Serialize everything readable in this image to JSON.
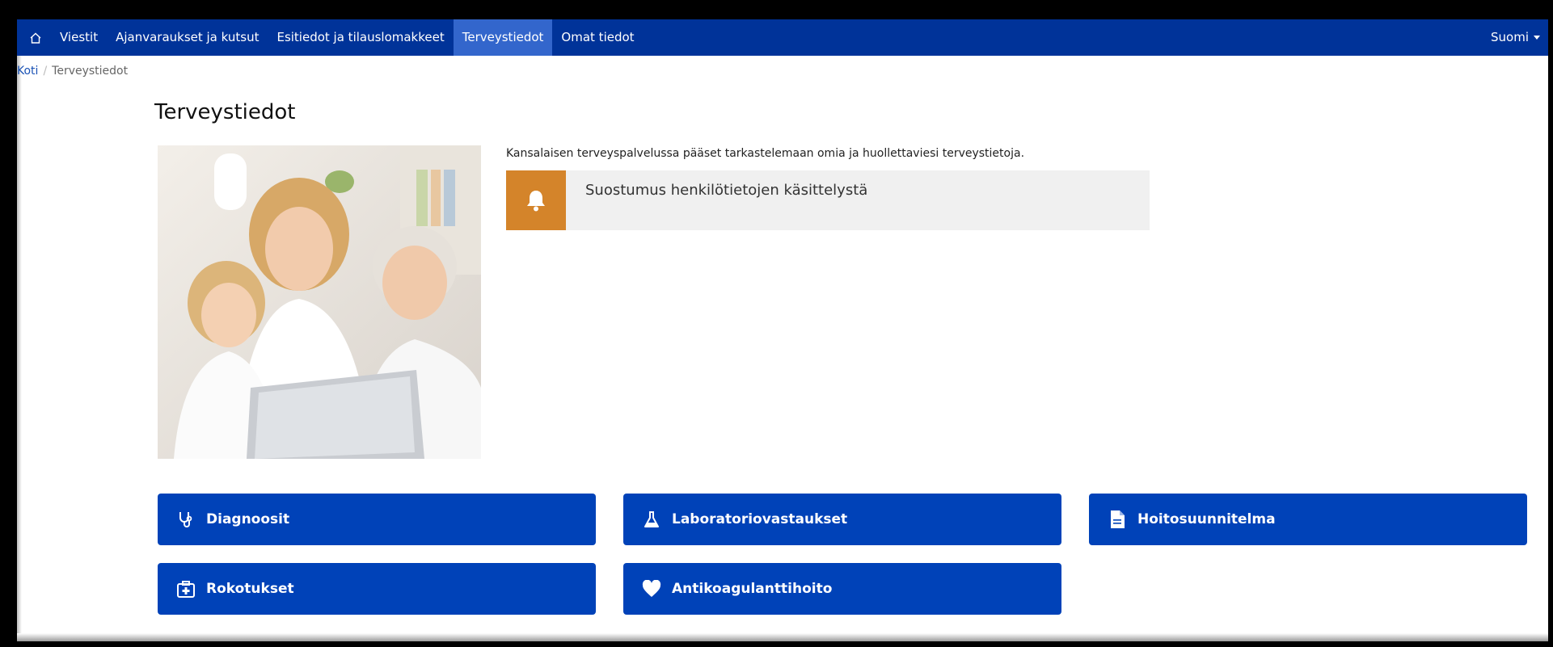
{
  "nav": {
    "home_icon": "home-icon",
    "items": [
      {
        "label": "Viestit"
      },
      {
        "label": "Ajanvaraukset ja kutsut"
      },
      {
        "label": "Esitiedot ja tilauslomakkeet"
      },
      {
        "label": "Terveystiedot",
        "active": true
      },
      {
        "label": "Omat tiedot"
      }
    ],
    "language": "Suomi"
  },
  "breadcrumb": {
    "home": "Koti",
    "separator": "/",
    "current": "Terveystiedot"
  },
  "page": {
    "title": "Terveystiedot",
    "intro": "Kansalaisen terveyspalvelussa pääset tarkastelemaan omia ja huollettaviesi terveystietoja."
  },
  "consent": {
    "icon": "bell-icon",
    "label": "Suostumus henkilötietojen käsittelystä"
  },
  "tiles": [
    {
      "label": "Diagnoosit",
      "icon": "stethoscope-icon"
    },
    {
      "label": "Laboratoriovastaukset",
      "icon": "flask-icon"
    },
    {
      "label": "Hoitosuunnitelma",
      "icon": "document-icon"
    },
    {
      "label": "Rokotukset",
      "icon": "first-aid-kit-icon"
    },
    {
      "label": "Antikoagulanttihoito",
      "icon": "heart-icon"
    }
  ],
  "colors": {
    "navbar": "#003399",
    "nav_active": "#3366cc",
    "tile": "#0042b8",
    "consent_accent": "#d4842a",
    "link": "#1a52b5"
  }
}
